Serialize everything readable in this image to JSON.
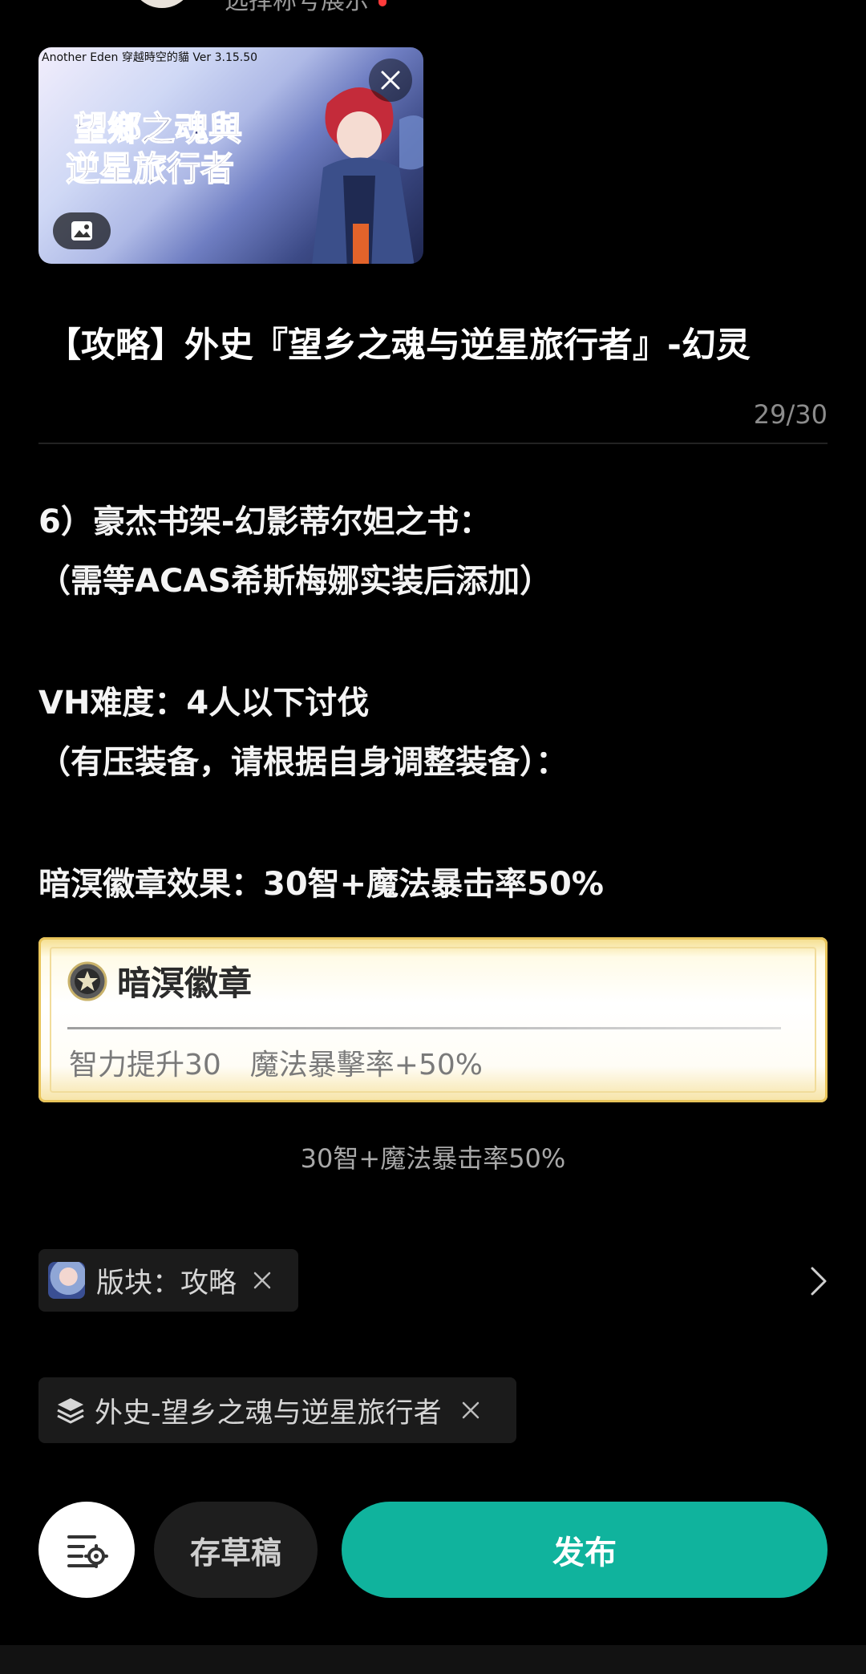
{
  "header": {
    "partial_label": "选择称号展示"
  },
  "cover": {
    "caption": "Another Eden 穿越時空的貓 Ver 3.15.50",
    "logo_line1": "望鄉之魂與",
    "logo_line2": "逆星旅行者",
    "close_icon": "close-icon",
    "image_icon": "image-icon"
  },
  "post": {
    "title": "【攻略】外史『望乡之魂与逆星旅行者』-幻灵",
    "char_count": "29/30",
    "paragraphs": [
      "6）豪杰书架-幻影蒂尔妲之书：",
      "（需等ACAS希斯梅娜实装后添加）",
      "VH难度：4人以下讨伐",
      "（有压装备，请根据自身调整装备）：",
      "暗溟徽章效果：30智+魔法暴击率50%"
    ]
  },
  "badge": {
    "name": "暗溟徽章",
    "effect": "智力提升30　魔法暴擊率+50%",
    "caption": "30智+魔法暴击率50%",
    "icon": "star-medal-icon"
  },
  "tags": {
    "board_label": "版块：攻略",
    "topic_label": "外史-望乡之魂与逆星旅行者"
  },
  "actions": {
    "draft_label": "存草稿",
    "publish_label": "发布",
    "settings_icon": "settings-icon"
  },
  "colors": {
    "accent": "#10b39d",
    "background": "#000000",
    "chip_bg": "#1b1b1b",
    "badge_gold": "#e8c45a"
  }
}
